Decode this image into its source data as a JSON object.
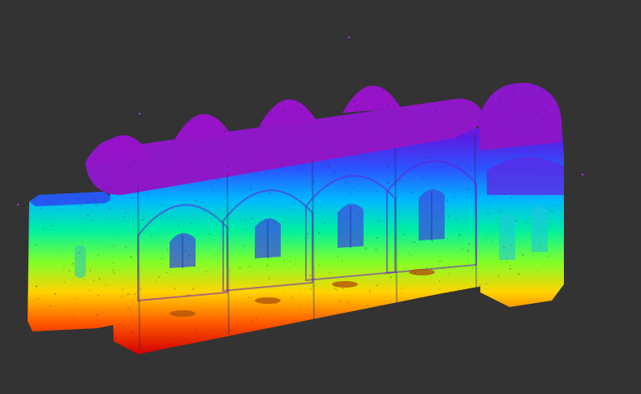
{
  "viewer": {
    "background": "#333333",
    "colormap": [
      "#d40000",
      "#ff5a00",
      "#ffd400",
      "#7dff2a",
      "#00f0a0",
      "#00b8ff",
      "#2a55ff",
      "#5a1ee6",
      "#8a17c9",
      "#9a12c8"
    ]
  },
  "model": {
    "icon": "point-cloud-icon",
    "bays": 5,
    "apse": true,
    "porch": true
  }
}
